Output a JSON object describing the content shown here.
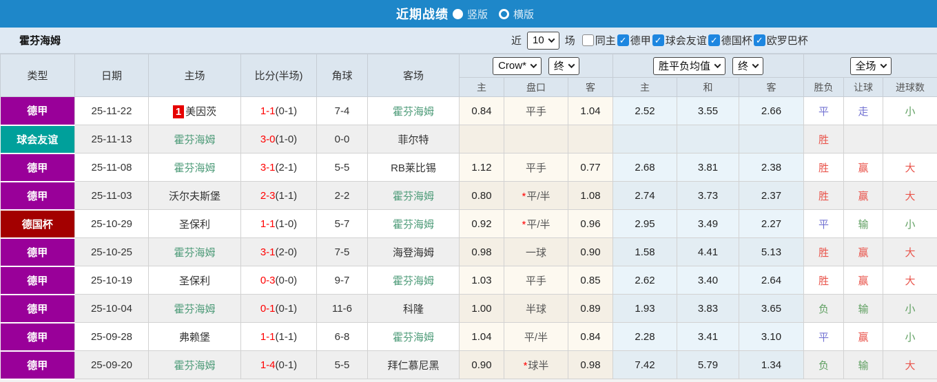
{
  "topbar": {
    "title": "近期战绩",
    "radio_vertical_label": "竖版",
    "radio_horizontal_label": "横版"
  },
  "filterbar": {
    "team": "霍芬海姆",
    "recent_label": "近",
    "count_value": "10",
    "games_label": "场",
    "same_home_label": "同主",
    "same_home_checked": false,
    "leagues": [
      {
        "label": "德甲",
        "checked": true
      },
      {
        "label": "球会友谊",
        "checked": true
      },
      {
        "label": "德国杯",
        "checked": true
      },
      {
        "label": "欧罗巴杯",
        "checked": true
      }
    ]
  },
  "table": {
    "left_headers": [
      "类型",
      "日期",
      "主场",
      "比分(半场)",
      "角球",
      "客场"
    ],
    "selects": {
      "odds_company": "Crow*",
      "odds_time": "终",
      "avg_name": "胜平负均值",
      "avg_time": "终",
      "full_match": "全场"
    },
    "sub_headers": [
      "主",
      "盘口",
      "客",
      "主",
      "和",
      "客",
      "胜负",
      "让球",
      "进球数"
    ],
    "rows": [
      {
        "type": "德甲",
        "type_color": "#990099",
        "date": "25-11-22",
        "home_rank": "1",
        "home": "美因茨",
        "home_is_team": false,
        "score": "1-1",
        "half": "(0-1)",
        "corners": "7-4",
        "away": "霍芬海姆",
        "away_is_team": true,
        "odds_home": "0.84",
        "handicap_star": false,
        "handicap": "平手",
        "odds_away": "1.04",
        "avg_home": "2.52",
        "avg_draw": "3.55",
        "avg_away": "2.66",
        "result": "平",
        "result_color": "blue",
        "handicap_result": "走",
        "handicap_result_color": "blue",
        "goals_result": "小",
        "goals_result_color": "green"
      },
      {
        "type": "球会友谊",
        "type_color": "#00a09b",
        "date": "25-11-13",
        "home_rank": "",
        "home": "霍芬海姆",
        "home_is_team": true,
        "score": "3-0",
        "half": "(1-0)",
        "corners": "0-0",
        "away": "菲尔特",
        "away_is_team": false,
        "odds_home": "",
        "handicap_star": false,
        "handicap": "",
        "odds_away": "",
        "avg_home": "",
        "avg_draw": "",
        "avg_away": "",
        "result": "胜",
        "result_color": "red",
        "handicap_result": "",
        "handicap_result_color": "",
        "goals_result": "",
        "goals_result_color": ""
      },
      {
        "type": "德甲",
        "type_color": "#990099",
        "date": "25-11-08",
        "home_rank": "",
        "home": "霍芬海姆",
        "home_is_team": true,
        "score": "3-1",
        "half": "(2-1)",
        "corners": "5-5",
        "away": "RB莱比锡",
        "away_is_team": false,
        "odds_home": "1.12",
        "handicap_star": false,
        "handicap": "平手",
        "odds_away": "0.77",
        "avg_home": "2.68",
        "avg_draw": "3.81",
        "avg_away": "2.38",
        "result": "胜",
        "result_color": "red",
        "handicap_result": "赢",
        "handicap_result_color": "red",
        "goals_result": "大",
        "goals_result_color": "red"
      },
      {
        "type": "德甲",
        "type_color": "#990099",
        "date": "25-11-03",
        "home_rank": "",
        "home": "沃尔夫斯堡",
        "home_is_team": false,
        "score": "2-3",
        "half": "(1-1)",
        "corners": "2-2",
        "away": "霍芬海姆",
        "away_is_team": true,
        "odds_home": "0.80",
        "handicap_star": true,
        "handicap": "平/半",
        "odds_away": "1.08",
        "avg_home": "2.74",
        "avg_draw": "3.73",
        "avg_away": "2.37",
        "result": "胜",
        "result_color": "red",
        "handicap_result": "赢",
        "handicap_result_color": "red",
        "goals_result": "大",
        "goals_result_color": "red"
      },
      {
        "type": "德国杯",
        "type_color": "#a30000",
        "date": "25-10-29",
        "home_rank": "",
        "home": "圣保利",
        "home_is_team": false,
        "score": "1-1",
        "half": "(1-0)",
        "corners": "5-7",
        "away": "霍芬海姆",
        "away_is_team": true,
        "odds_home": "0.92",
        "handicap_star": true,
        "handicap": "平/半",
        "odds_away": "0.96",
        "avg_home": "2.95",
        "avg_draw": "3.49",
        "avg_away": "2.27",
        "result": "平",
        "result_color": "blue",
        "handicap_result": "输",
        "handicap_result_color": "green",
        "goals_result": "小",
        "goals_result_color": "green"
      },
      {
        "type": "德甲",
        "type_color": "#990099",
        "date": "25-10-25",
        "home_rank": "",
        "home": "霍芬海姆",
        "home_is_team": true,
        "score": "3-1",
        "half": "(2-0)",
        "corners": "7-5",
        "away": "海登海姆",
        "away_is_team": false,
        "odds_home": "0.98",
        "handicap_star": false,
        "handicap": "一球",
        "odds_away": "0.90",
        "avg_home": "1.58",
        "avg_draw": "4.41",
        "avg_away": "5.13",
        "result": "胜",
        "result_color": "red",
        "handicap_result": "赢",
        "handicap_result_color": "red",
        "goals_result": "大",
        "goals_result_color": "red"
      },
      {
        "type": "德甲",
        "type_color": "#990099",
        "date": "25-10-19",
        "home_rank": "",
        "home": "圣保利",
        "home_is_team": false,
        "score": "0-3",
        "half": "(0-0)",
        "corners": "9-7",
        "away": "霍芬海姆",
        "away_is_team": true,
        "odds_home": "1.03",
        "handicap_star": false,
        "handicap": "平手",
        "odds_away": "0.85",
        "avg_home": "2.62",
        "avg_draw": "3.40",
        "avg_away": "2.64",
        "result": "胜",
        "result_color": "red",
        "handicap_result": "赢",
        "handicap_result_color": "red",
        "goals_result": "大",
        "goals_result_color": "red"
      },
      {
        "type": "德甲",
        "type_color": "#990099",
        "date": "25-10-04",
        "home_rank": "",
        "home": "霍芬海姆",
        "home_is_team": true,
        "score": "0-1",
        "half": "(0-1)",
        "corners": "11-6",
        "away": "科隆",
        "away_is_team": false,
        "odds_home": "1.00",
        "handicap_star": false,
        "handicap": "半球",
        "odds_away": "0.89",
        "avg_home": "1.93",
        "avg_draw": "3.83",
        "avg_away": "3.65",
        "result": "负",
        "result_color": "green",
        "handicap_result": "输",
        "handicap_result_color": "green",
        "goals_result": "小",
        "goals_result_color": "green"
      },
      {
        "type": "德甲",
        "type_color": "#990099",
        "date": "25-09-28",
        "home_rank": "",
        "home": "弗赖堡",
        "home_is_team": false,
        "score": "1-1",
        "half": "(1-1)",
        "corners": "6-8",
        "away": "霍芬海姆",
        "away_is_team": true,
        "odds_home": "1.04",
        "handicap_star": false,
        "handicap": "平/半",
        "odds_away": "0.84",
        "avg_home": "2.28",
        "avg_draw": "3.41",
        "avg_away": "3.10",
        "result": "平",
        "result_color": "blue",
        "handicap_result": "赢",
        "handicap_result_color": "red",
        "goals_result": "小",
        "goals_result_color": "green"
      },
      {
        "type": "德甲",
        "type_color": "#990099",
        "date": "25-09-20",
        "home_rank": "",
        "home": "霍芬海姆",
        "home_is_team": true,
        "score": "1-4",
        "half": "(0-1)",
        "corners": "5-5",
        "away": "拜仁慕尼黑",
        "away_is_team": false,
        "odds_home": "0.90",
        "handicap_star": true,
        "handicap": "球半",
        "odds_away": "0.98",
        "avg_home": "7.42",
        "avg_draw": "5.79",
        "avg_away": "1.34",
        "result": "负",
        "result_color": "green",
        "handicap_result": "输",
        "handicap_result_color": "green",
        "goals_result": "大",
        "goals_result_color": "red"
      }
    ]
  },
  "colors": {
    "topbar_bg": "#1e87c9",
    "league_bundesliga": "#990099",
    "league_friendly": "#00a09b",
    "league_dfb_pokal": "#a30000",
    "win_red": "#e9544b",
    "draw_blue": "#7272d2",
    "lose_green": "#60a062",
    "team_green": "#4d9b78",
    "score_red": "#ff0000"
  }
}
